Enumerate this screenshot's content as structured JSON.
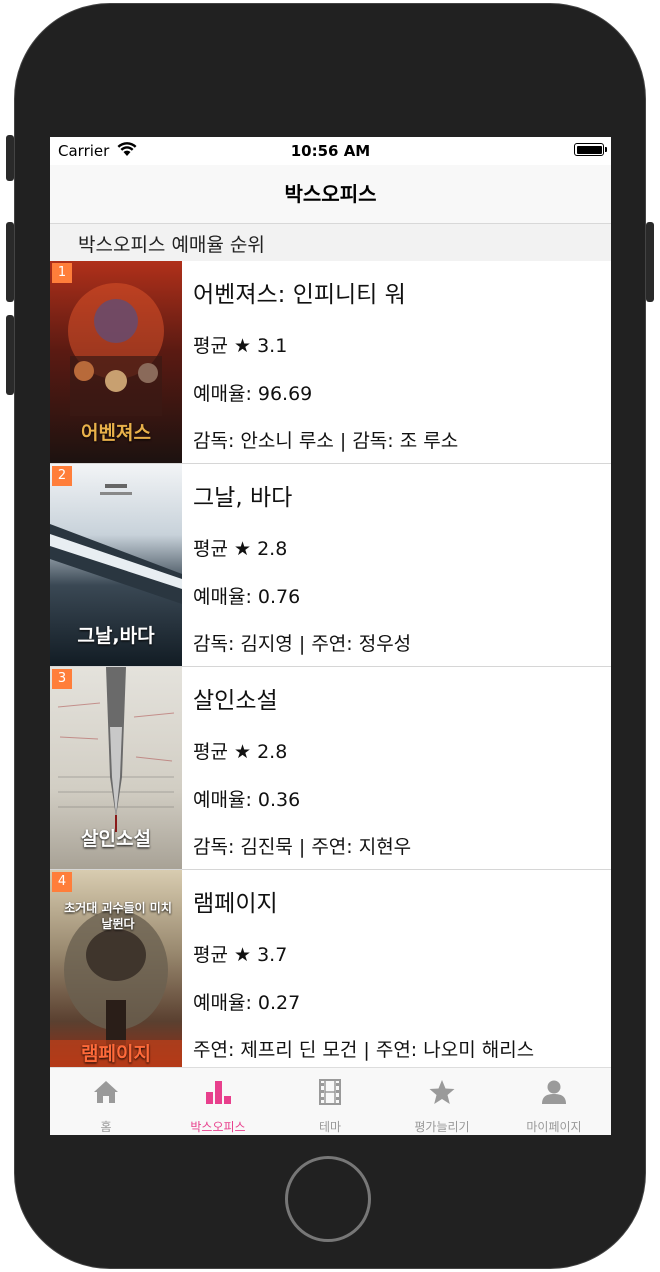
{
  "status_bar": {
    "carrier": "Carrier",
    "time": "10:56 AM"
  },
  "nav": {
    "title": "박스오피스"
  },
  "section": {
    "header": "박스오피스 예매율 순위"
  },
  "movies": [
    {
      "rank": "1",
      "title": "어벤져스: 인피니티 워",
      "rating": "평균 ★ 3.1",
      "reservation": "예매율: 96.69",
      "credits": "감독: 안소니 루소 | 감독: 조 루소",
      "poster_text": "어벤져스",
      "poster_colors": [
        "#7a1a10",
        "#2a1410"
      ]
    },
    {
      "rank": "2",
      "title": "그날, 바다",
      "rating": "평균 ★ 2.8",
      "reservation": "예매율: 0.76",
      "credits": "감독: 김지영 | 주연: 정우성",
      "poster_text": "그날,바다",
      "poster_colors": [
        "#e8eef2",
        "#1a2630"
      ]
    },
    {
      "rank": "3",
      "title": "살인소설",
      "rating": "평균 ★ 2.8",
      "reservation": "예매율: 0.36",
      "credits": "감독: 김진묵 | 주연: 지현우",
      "poster_text": "살인소설",
      "poster_colors": [
        "#d9d6ce",
        "#8a8478"
      ]
    },
    {
      "rank": "4",
      "title": "램페이지",
      "rating": "평균 ★ 3.7",
      "reservation": "예매율: 0.27",
      "credits": "주연: 제프리 딘 모건 | 주연: 나오미 해리스",
      "poster_text": "램페이지",
      "poster_tagline": "초거대 괴수들이 미치 날뛴다",
      "poster_colors": [
        "#b8a888",
        "#3a2418"
      ]
    }
  ],
  "tabs": [
    {
      "label": "홈",
      "icon": "home-icon",
      "active": false
    },
    {
      "label": "박스오피스",
      "icon": "bar-chart-icon",
      "active": true
    },
    {
      "label": "테마",
      "icon": "film-icon",
      "active": false
    },
    {
      "label": "평가늘리기",
      "icon": "star-icon",
      "active": false
    },
    {
      "label": "마이페이지",
      "icon": "person-icon",
      "active": false
    }
  ],
  "colors": {
    "accent": "#e8408d",
    "rank_badge": "#ff7e3a",
    "tab_inactive": "#999999"
  }
}
